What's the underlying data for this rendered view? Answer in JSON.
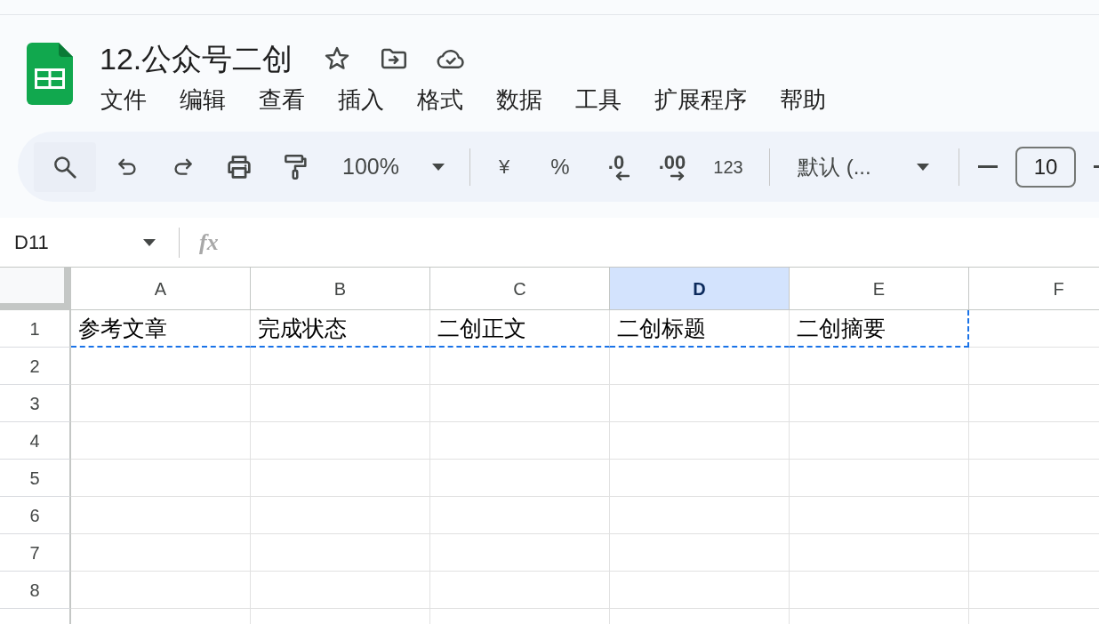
{
  "document": {
    "title": "12.公众号二创"
  },
  "menu": [
    "文件",
    "编辑",
    "查看",
    "插入",
    "格式",
    "数据",
    "工具",
    "扩展程序",
    "帮助"
  ],
  "toolbar": {
    "zoom": "100%",
    "currency": "¥",
    "percent": "%",
    "decrease_decimal": ".0",
    "increase_decimal": ".00",
    "more_formats": "123",
    "font": "默认 (...",
    "font_size": "10"
  },
  "formula_bar": {
    "name_box": "D11",
    "function_label": "fx"
  },
  "sheet": {
    "columns": [
      {
        "label": "A",
        "selected": false
      },
      {
        "label": "B",
        "selected": false
      },
      {
        "label": "C",
        "selected": false
      },
      {
        "label": "D",
        "selected": true
      },
      {
        "label": "E",
        "selected": false
      },
      {
        "label": "F",
        "selected": false
      }
    ],
    "rows": [
      {
        "label": "1",
        "cells": [
          {
            "text": "参考文章",
            "copied": true
          },
          {
            "text": "完成状态",
            "copied": true
          },
          {
            "text": "二创正文",
            "copied": true
          },
          {
            "text": "二创标题",
            "copied": true
          },
          {
            "text": "二创摘要",
            "copied": true
          }
        ]
      },
      {
        "label": "2"
      },
      {
        "label": "3"
      },
      {
        "label": "4"
      },
      {
        "label": "5"
      },
      {
        "label": "6"
      },
      {
        "label": "7"
      },
      {
        "label": "8"
      }
    ]
  }
}
